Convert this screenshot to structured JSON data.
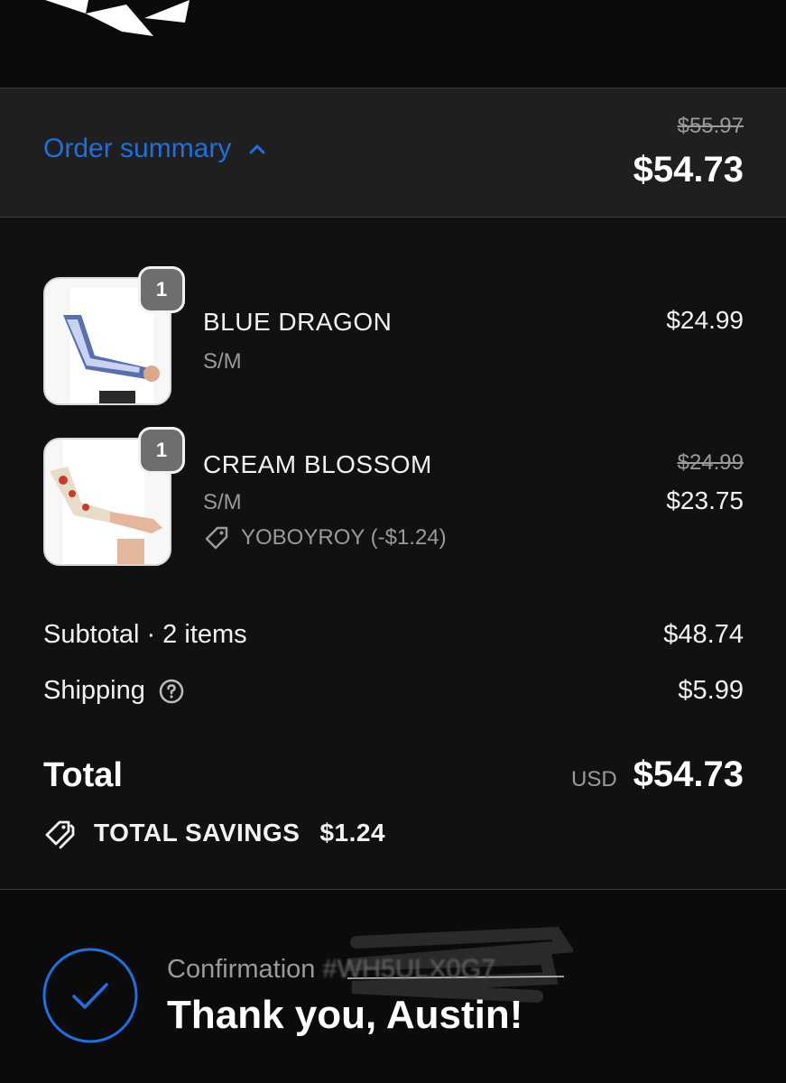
{
  "order_summary": {
    "toggle_label": "Order summary",
    "original_total": "$55.97",
    "total": "$54.73"
  },
  "items": [
    {
      "quantity": "1",
      "name": "BLUE DRAGON",
      "variant": "S/M",
      "price": "$24.99"
    },
    {
      "quantity": "1",
      "name": "CREAM BLOSSOM",
      "variant": "S/M",
      "discount": "YOBOYROY (-$1.24)",
      "original_price": "$24.99",
      "price": "$23.75"
    }
  ],
  "totals": {
    "subtotal_label": "Subtotal · 2 items",
    "subtotal_value": "$48.74",
    "shipping_label": "Shipping",
    "shipping_value": "$5.99",
    "total_label": "Total",
    "currency": "USD",
    "total_value": "$54.73",
    "savings_label": "TOTAL SAVINGS",
    "savings_value": "$1.24"
  },
  "confirmation": {
    "label": "Confirmation",
    "number": "#WH5ULX0G7",
    "thank_you": "Thank you, Austin!"
  },
  "colors": {
    "accent": "#1e6fe0",
    "background": "#111111",
    "bar": "#1f1f1f",
    "muted": "#9a9a9a"
  }
}
